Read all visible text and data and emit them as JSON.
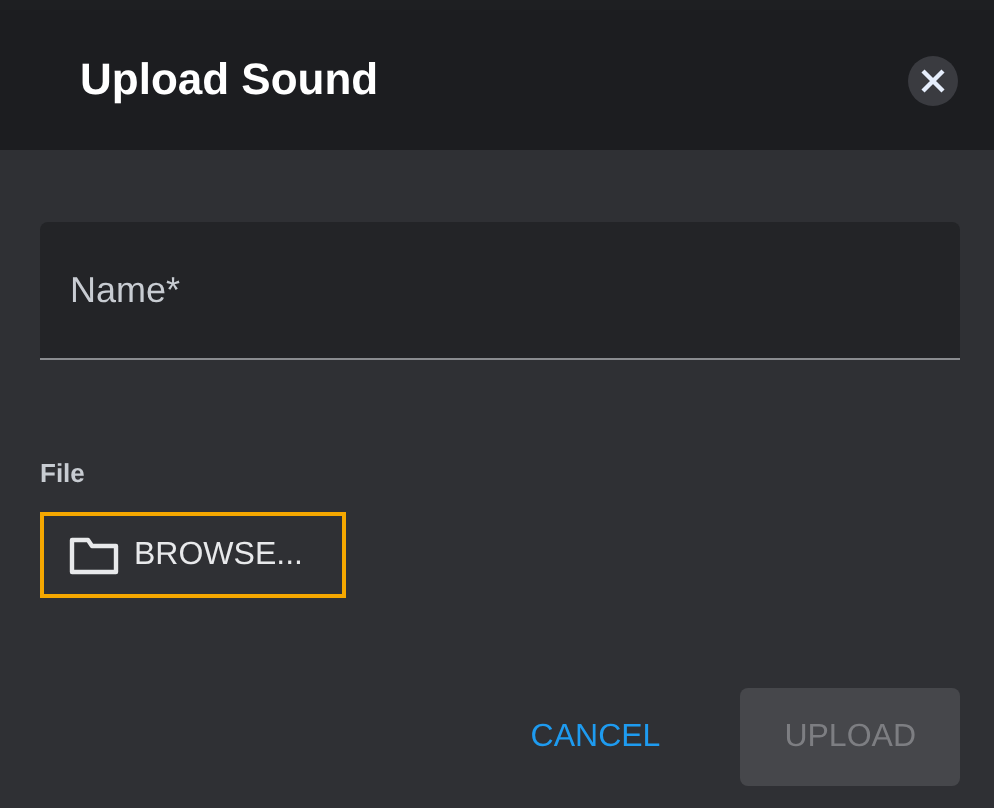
{
  "dialog": {
    "title": "Upload Sound"
  },
  "name_field": {
    "placeholder": "Name*"
  },
  "file": {
    "label": "File",
    "browse": {
      "label": "BROWSE...",
      "focused": true
    }
  },
  "buttons": [
    {
      "label": "CANCEL",
      "kind": "text",
      "disabled": false
    },
    {
      "label": "UPLOAD",
      "kind": "contained",
      "disabled": true
    }
  ]
}
